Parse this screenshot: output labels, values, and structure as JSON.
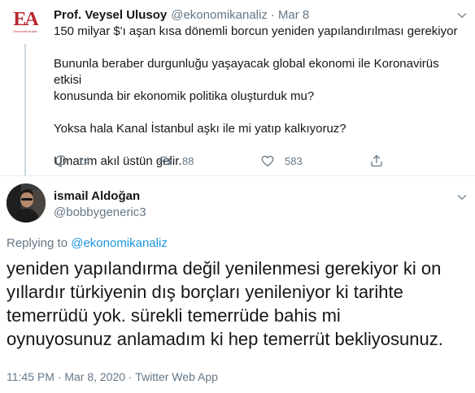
{
  "parent_tweet": {
    "logo_letters": "EA",
    "logo_subtitle": "Ekonomik Analiz",
    "name": "Prof. Veysel Ulusoy",
    "handle": "@ekonomikanaliz",
    "separator": "·",
    "date": "Mar 8",
    "lines": [
      "150 milyar $'ı aşan kısa dönemli borcun yeniden yapılandırılması gerekiyor",
      "",
      "Bununla beraber durgunluğu yaşayacak global ekonomi ile Koronavirüs etkisi",
      "konusunda bir ekonomik politika oluşturduk mu?",
      "",
      "Yoksa hala Kanal İstanbul aşkı ile mi yatıp kalkıyoruz?",
      "",
      "Umarım akıl üstün gelir."
    ],
    "actions": {
      "reply_count": "14",
      "retweet_count": "88",
      "like_count": "583"
    }
  },
  "main_tweet": {
    "name": "ismail Aldoğan",
    "handle": "@bobbygeneric3",
    "replying_prefix": "Replying to",
    "replying_handle": "@ekonomikanaliz",
    "lines": [
      "yeniden yapılandırma değil yenilenmesi gerekiyor ki on",
      "yıllardır türkiyenin dış borçları yenileniyor ki tarihte",
      "temerrüdü yok. sürekli temerrüde bahis mi",
      "oynuyosunuz anlamadım ki hep temerrüt bekliyosunuz."
    ],
    "timestamp": "11:45 PM · Mar 8, 2020 · Twitter Web App"
  },
  "icons": {
    "caret": "chevron-down-icon",
    "reply": "reply-icon",
    "retweet": "retweet-icon",
    "like": "heart-icon",
    "share": "share-icon"
  },
  "colors": {
    "text": "#14171a",
    "secondary": "#657786",
    "link": "#1b95e0",
    "divider": "#e6ecf0",
    "logo": "#b8252c"
  }
}
